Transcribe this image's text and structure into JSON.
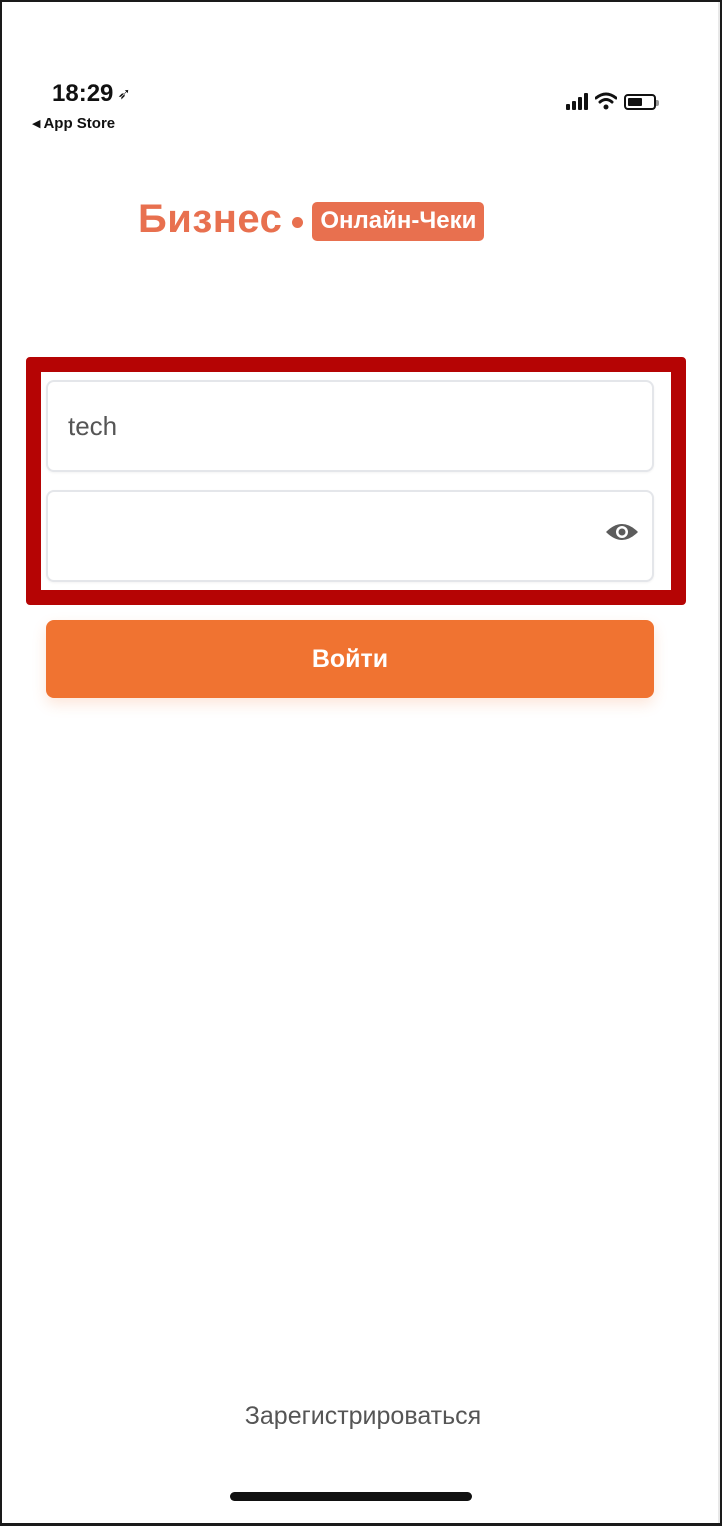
{
  "status_bar": {
    "time": "18:29",
    "back_app": "App Store",
    "icons": [
      "location-arrow-icon",
      "cellular-signal-icon",
      "wifi-icon",
      "battery-icon"
    ]
  },
  "logo": {
    "brand": "Бизнес",
    "badge": "Онлайн-Чеки",
    "color": "#e8704f"
  },
  "form": {
    "login_value": "tech",
    "password_value": "",
    "password_toggle_icon": "eye-icon",
    "submit_label": "Войти",
    "highlight_color": "#b50404",
    "button_color": "#f07331"
  },
  "footer": {
    "register_label": "Зарегистрироваться"
  }
}
